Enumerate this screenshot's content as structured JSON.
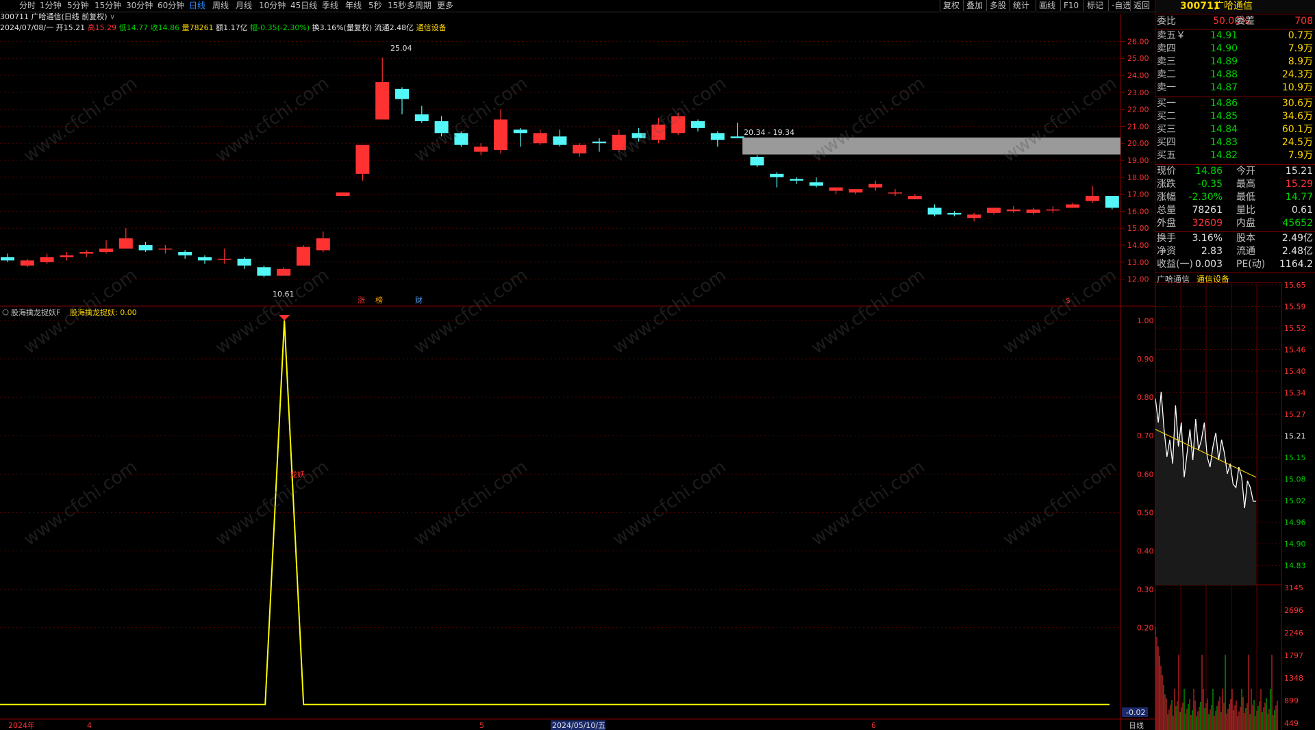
{
  "toolbar": {
    "periods": [
      "分时",
      "1分钟",
      "5分钟",
      "15分钟",
      "30分钟",
      "60分钟",
      "日线",
      "周线",
      "月线",
      "10分钟",
      "45日线",
      "季线",
      "年线",
      "5秒",
      "15秒",
      "多周期",
      "更多"
    ],
    "active": "日线",
    "right_buttons": [
      "复权",
      "叠加",
      "多股",
      "统计",
      "画线",
      "F10",
      "标记",
      "-自选",
      "返回"
    ]
  },
  "header": {
    "title": "300711 广哈通信(日线 前复权)",
    "info_date": "2024/07/08/一",
    "open_label": "开15.21",
    "high_label": "高15.29",
    "low_label": "低14.77",
    "close_label": "收14.86",
    "vol_label": "量78261",
    "amount_label": "额1.17亿",
    "change_label": "幅-0.35(-2.30%)",
    "turnover_label": "换3.16%(量复权)",
    "float_label": "流通2.48亿",
    "sector_label": "通信设备"
  },
  "indicator": {
    "title": "股海擒龙捉妖F",
    "value_label": "股海擒龙捉妖: 0.00",
    "signal_label": "龙妖"
  },
  "timeline": {
    "year_label": "2024年",
    "month4": "4",
    "month5": "5",
    "cursor_date": "2024/05/10/五",
    "month6": "6",
    "period_label": "日线"
  },
  "annotations": {
    "high_marker": "25.04",
    "low_marker": "10.61",
    "box_range": "20.34 - 19.34",
    "tags": [
      "涨",
      "榜",
      "财",
      "$"
    ]
  },
  "quote": {
    "code": "300711",
    "name": "广哈通信",
    "weibi_label": "委比",
    "weibi_value": "50.00%",
    "weicha_label": "委差",
    "weicha_value": "708",
    "asks": [
      {
        "label": "卖五￥",
        "price": "14.91",
        "vol": "0.7万"
      },
      {
        "label": "卖四",
        "price": "14.90",
        "vol": "7.9万"
      },
      {
        "label": "卖三",
        "price": "14.89",
        "vol": "8.9万"
      },
      {
        "label": "卖二",
        "price": "14.88",
        "vol": "24.3万"
      },
      {
        "label": "卖一",
        "price": "14.87",
        "vol": "10.9万"
      }
    ],
    "bids": [
      {
        "label": "买一",
        "price": "14.86",
        "vol": "30.6万"
      },
      {
        "label": "买二",
        "price": "14.85",
        "vol": "34.6万"
      },
      {
        "label": "买三",
        "price": "14.84",
        "vol": "60.1万"
      },
      {
        "label": "买四",
        "price": "14.83",
        "vol": "24.5万"
      },
      {
        "label": "买五",
        "price": "14.82",
        "vol": "7.9万"
      }
    ],
    "stats": [
      {
        "l1": "现价",
        "v1": "14.86",
        "l2": "今开",
        "v2": "15.21"
      },
      {
        "l1": "涨跌",
        "v1": "-0.35",
        "l2": "最高",
        "v2": "15.29"
      },
      {
        "l1": "涨幅",
        "v1": "-2.30%",
        "l2": "最低",
        "v2": "14.77"
      },
      {
        "l1": "总量",
        "v1": "78261",
        "l2": "量比",
        "v2": "0.61"
      },
      {
        "l1": "外盘",
        "v1": "32609",
        "l2": "内盘",
        "v2": "45652"
      }
    ],
    "stats2": [
      {
        "l1": "换手",
        "v1": "3.16%",
        "l2": "股本",
        "v2": "2.49亿"
      },
      {
        "l1": "净资",
        "v1": "2.83",
        "l2": "流通",
        "v2": "2.48亿"
      },
      {
        "l1": "收益(一)",
        "v1": "0.003",
        "l2": "PE(动)",
        "v2": "1164.2"
      }
    ],
    "mini_name": "广哈通信",
    "mini_sector": "通信设备",
    "mini_price_ticks": [
      "15.65",
      "15.59",
      "15.52",
      "15.46",
      "15.40",
      "15.34",
      "15.27",
      "15.21",
      "15.15",
      "15.08",
      "15.02",
      "14.96",
      "14.90",
      "14.83"
    ],
    "mini_vol_ticks": [
      "3145",
      "2696",
      "2246",
      "1797",
      "1348",
      "899",
      "449"
    ]
  },
  "watermark": "www.cfchi.com",
  "chart_data": [
    {
      "type": "candlestick",
      "title": "300711 广哈通信(日线 前复权)",
      "ylim": [
        11.5,
        26.5
      ],
      "yticks": [
        12,
        13,
        14,
        15,
        16,
        17,
        18,
        19,
        20,
        21,
        22,
        23,
        24,
        25,
        26
      ],
      "up_color": "#ff3232",
      "down_color": "#53f7f7",
      "candles": [
        {
          "o": 13.3,
          "c": 13.1,
          "h": 13.5,
          "l": 13.0
        },
        {
          "o": 12.8,
          "c": 13.1,
          "h": 13.2,
          "l": 12.7
        },
        {
          "o": 13.0,
          "c": 13.3,
          "h": 13.5,
          "l": 12.9
        },
        {
          "o": 13.3,
          "c": 13.4,
          "h": 13.6,
          "l": 13.1
        },
        {
          "o": 13.5,
          "c": 13.6,
          "h": 13.7,
          "l": 13.3
        },
        {
          "o": 13.6,
          "c": 13.8,
          "h": 14.3,
          "l": 13.5
        },
        {
          "o": 13.8,
          "c": 14.4,
          "h": 15.0,
          "l": 13.8
        },
        {
          "o": 14.0,
          "c": 13.7,
          "h": 14.2,
          "l": 13.6
        },
        {
          "o": 13.8,
          "c": 13.8,
          "h": 14.0,
          "l": 13.5
        },
        {
          "o": 13.6,
          "c": 13.4,
          "h": 13.7,
          "l": 13.2
        },
        {
          "o": 13.3,
          "c": 13.1,
          "h": 13.4,
          "l": 12.9
        },
        {
          "o": 13.2,
          "c": 13.2,
          "h": 13.8,
          "l": 12.9
        },
        {
          "o": 13.2,
          "c": 12.8,
          "h": 13.3,
          "l": 12.6
        },
        {
          "o": 12.7,
          "c": 12.2,
          "h": 12.8,
          "l": 12.1
        },
        {
          "o": 12.2,
          "c": 12.6,
          "h": 12.7,
          "l": 12.2
        },
        {
          "o": 12.8,
          "c": 13.9,
          "h": 14.0,
          "l": 12.8
        },
        {
          "o": 13.7,
          "c": 14.4,
          "h": 14.8,
          "l": 13.6
        },
        {
          "o": 16.9,
          "c": 17.1,
          "h": 17.1,
          "l": 16.9
        },
        {
          "o": 18.2,
          "c": 19.9,
          "h": 19.9,
          "l": 17.8
        },
        {
          "o": 21.4,
          "c": 23.6,
          "h": 25.04,
          "l": 21.4
        },
        {
          "o": 23.2,
          "c": 22.6,
          "h": 23.3,
          "l": 21.7
        },
        {
          "o": 21.7,
          "c": 21.3,
          "h": 22.2,
          "l": 21.2
        },
        {
          "o": 21.3,
          "c": 20.6,
          "h": 21.6,
          "l": 20.4
        },
        {
          "o": 20.6,
          "c": 19.9,
          "h": 20.7,
          "l": 19.8
        },
        {
          "o": 19.5,
          "c": 19.8,
          "h": 20.0,
          "l": 19.3
        },
        {
          "o": 19.6,
          "c": 21.4,
          "h": 22.0,
          "l": 19.4
        },
        {
          "o": 20.8,
          "c": 20.6,
          "h": 20.9,
          "l": 19.8
        },
        {
          "o": 20.0,
          "c": 20.6,
          "h": 20.8,
          "l": 19.9
        },
        {
          "o": 20.4,
          "c": 19.9,
          "h": 20.8,
          "l": 19.8
        },
        {
          "o": 19.4,
          "c": 19.9,
          "h": 20.0,
          "l": 19.2
        },
        {
          "o": 20.1,
          "c": 20.0,
          "h": 20.3,
          "l": 19.5
        },
        {
          "o": 19.6,
          "c": 20.5,
          "h": 20.8,
          "l": 19.5
        },
        {
          "o": 20.6,
          "c": 20.3,
          "h": 20.9,
          "l": 20.1
        },
        {
          "o": 20.2,
          "c": 21.1,
          "h": 21.5,
          "l": 20.0
        },
        {
          "o": 20.6,
          "c": 21.6,
          "h": 21.8,
          "l": 20.5
        },
        {
          "o": 21.3,
          "c": 20.9,
          "h": 21.4,
          "l": 20.7
        },
        {
          "o": 20.6,
          "c": 20.2,
          "h": 20.7,
          "l": 19.8
        },
        {
          "o": 20.4,
          "c": 20.3,
          "h": 21.2,
          "l": 20.3
        },
        {
          "o": 19.2,
          "c": 18.7,
          "h": 19.3,
          "l": 18.6
        },
        {
          "o": 18.2,
          "c": 18.0,
          "h": 18.3,
          "l": 17.4
        },
        {
          "o": 17.9,
          "c": 17.8,
          "h": 18.0,
          "l": 17.6
        },
        {
          "o": 17.7,
          "c": 17.5,
          "h": 18.0,
          "l": 17.4
        },
        {
          "o": 17.2,
          "c": 17.4,
          "h": 17.4,
          "l": 17.0
        },
        {
          "o": 17.1,
          "c": 17.3,
          "h": 17.3,
          "l": 17.0
        },
        {
          "o": 17.4,
          "c": 17.6,
          "h": 17.8,
          "l": 17.2
        },
        {
          "o": 17.1,
          "c": 17.1,
          "h": 17.3,
          "l": 16.9
        },
        {
          "o": 16.7,
          "c": 16.9,
          "h": 17.0,
          "l": 16.7
        },
        {
          "o": 16.2,
          "c": 15.8,
          "h": 16.4,
          "l": 15.7
        },
        {
          "o": 15.9,
          "c": 15.8,
          "h": 16.0,
          "l": 15.7
        },
        {
          "o": 15.6,
          "c": 15.8,
          "h": 15.9,
          "l": 15.4
        },
        {
          "o": 15.9,
          "c": 16.2,
          "h": 16.2,
          "l": 15.8
        },
        {
          "o": 16.0,
          "c": 16.1,
          "h": 16.3,
          "l": 15.9
        },
        {
          "o": 15.9,
          "c": 16.1,
          "h": 16.2,
          "l": 15.8
        },
        {
          "o": 16.1,
          "c": 16.1,
          "h": 16.3,
          "l": 15.9
        },
        {
          "o": 16.2,
          "c": 16.4,
          "h": 16.5,
          "l": 16.2
        },
        {
          "o": 16.6,
          "c": 16.9,
          "h": 17.5,
          "l": 16.5
        },
        {
          "o": 16.9,
          "c": 16.2,
          "h": 16.9,
          "l": 16.1
        }
      ]
    },
    {
      "type": "line",
      "title": "股海擒龙捉妖F",
      "ylim": [
        -0.02,
        1.0
      ],
      "yticks": [
        "1.00",
        "0.90",
        "0.80",
        "0.70",
        "0.60",
        "0.50",
        "0.40",
        "0.30",
        "0.20",
        "-0.02"
      ],
      "spike_index": 14,
      "spike_value": 1.0,
      "base_value": 0.0,
      "color": "#ffff00"
    }
  ]
}
